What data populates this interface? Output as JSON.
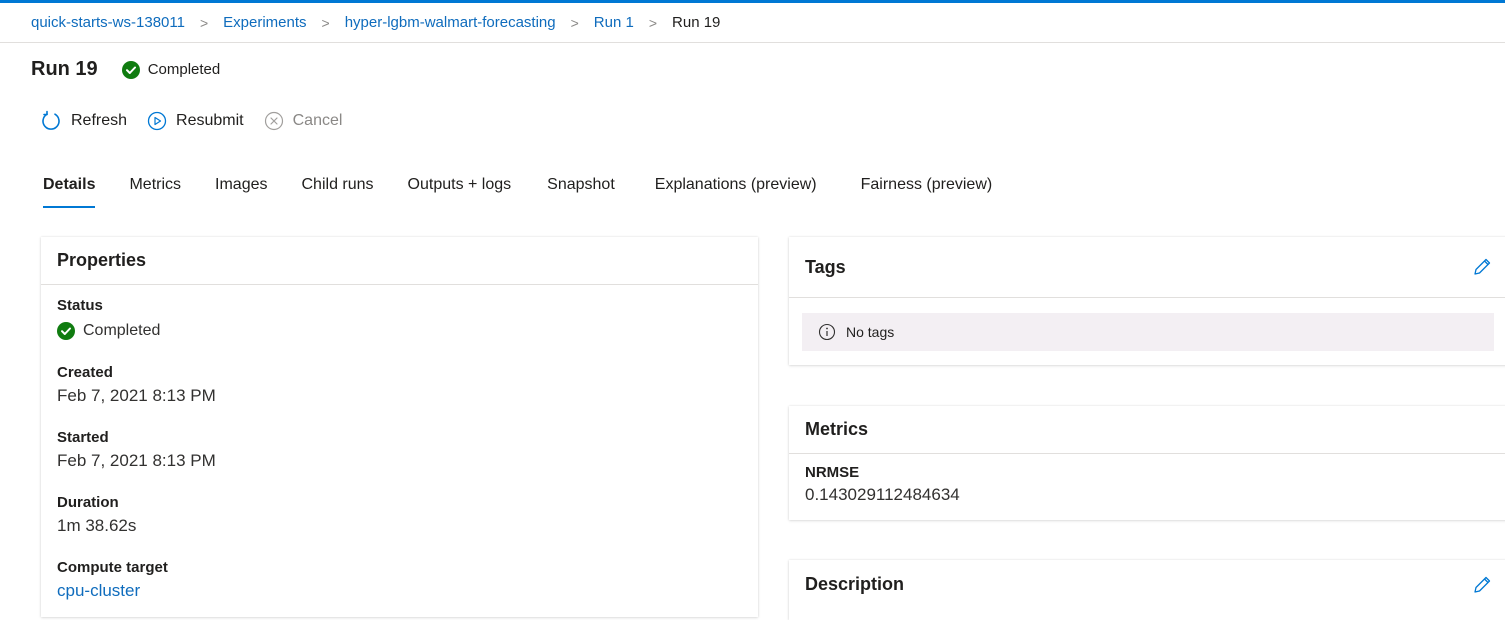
{
  "breadcrumb": [
    "quick-starts-ws-138011",
    "Experiments",
    "hyper-lgbm-walmart-forecasting",
    "Run 1",
    "Run 19"
  ],
  "breadcrumb_separator": ">",
  "run": {
    "title": "Run 19",
    "status": "Completed"
  },
  "commands": {
    "refresh": "Refresh",
    "resubmit": "Resubmit",
    "cancel": "Cancel"
  },
  "tabs": [
    "Details",
    "Metrics",
    "Images",
    "Child runs",
    "Outputs + logs",
    "Snapshot",
    "Explanations (preview)",
    "Fairness (preview)"
  ],
  "active_tab": "Details",
  "properties": {
    "title": "Properties",
    "status_label": "Status",
    "status_value": "Completed",
    "created_label": "Created",
    "created_value": "Feb 7, 2021 8:13 PM",
    "started_label": "Started",
    "started_value": "Feb 7, 2021 8:13 PM",
    "duration_label": "Duration",
    "duration_value": "1m 38.62s",
    "compute_label": "Compute target",
    "compute_value": "cpu-cluster"
  },
  "tags": {
    "title": "Tags",
    "empty_text": "No tags"
  },
  "metrics": {
    "title": "Metrics",
    "name": "NRMSE",
    "value": "0.143029112484634"
  },
  "description": {
    "title": "Description"
  },
  "colors": {
    "accent": "#0078d4",
    "link": "#0f6cbd",
    "success": "#107c10",
    "tag_bg": "#f3eff3"
  },
  "icons": [
    "check-circle-icon",
    "refresh-icon",
    "play-circle-icon",
    "cancel-icon",
    "edit-icon",
    "info-icon"
  ]
}
